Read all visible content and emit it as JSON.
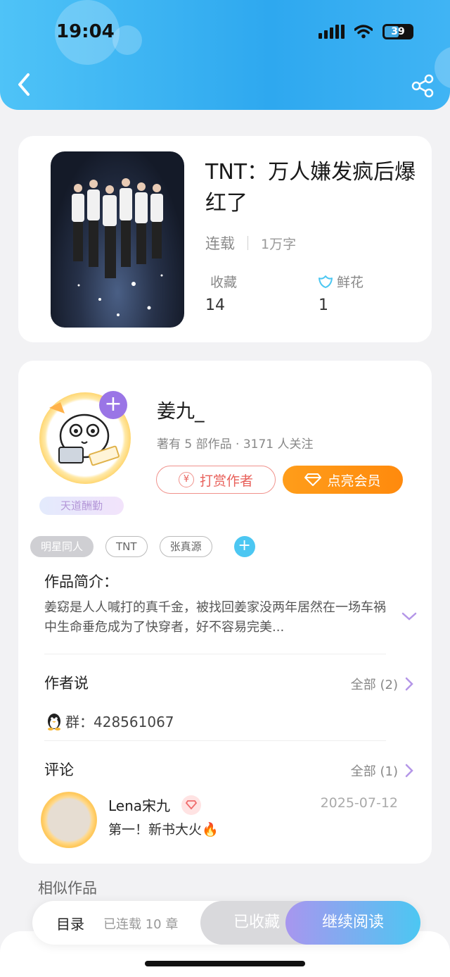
{
  "status_bar": {
    "time": "19:04",
    "battery": "39"
  },
  "book": {
    "title": "TNT：万人嫌发疯后爆红了",
    "status": "连载",
    "word_count": "1万字",
    "stats": {
      "favorites_label": "收藏",
      "favorites_value": "14",
      "flowers_label": "鲜花",
      "flowers_value": "1"
    }
  },
  "author": {
    "name": "姜九_",
    "info": "著有 5 部作品 · 3171 人关注",
    "badge": "天道酬勤",
    "tip_button": "打赏作者",
    "vip_button": "点亮会员"
  },
  "tags": [
    "明星同人",
    "TNT",
    "张真源"
  ],
  "intro": {
    "title": "作品简介：",
    "text": "姜窈是人人喊打的真千金，被找回姜家没两年居然在一场车祸中生命垂危成为了快穿者，好不容易完美..."
  },
  "author_says": {
    "title": "作者说",
    "more": "全部 (2)",
    "group": "群：428561067"
  },
  "comments": {
    "title": "评论",
    "more": "全部 (1)",
    "items": [
      {
        "user": "Lena宋九",
        "date": "2025-07-12",
        "text": "第一！新书大火🔥"
      }
    ]
  },
  "similar_title": "相似作品",
  "bottom": {
    "toc": "目录",
    "chapters": "已连载 10 章",
    "favorited": "已收藏",
    "continue": "继续阅读"
  },
  "colors": {
    "header": "#2ea8ef",
    "accent_purple": "#9a75e6",
    "vip_orange": "#ff9d1a",
    "tip_red": "#e8605a"
  }
}
